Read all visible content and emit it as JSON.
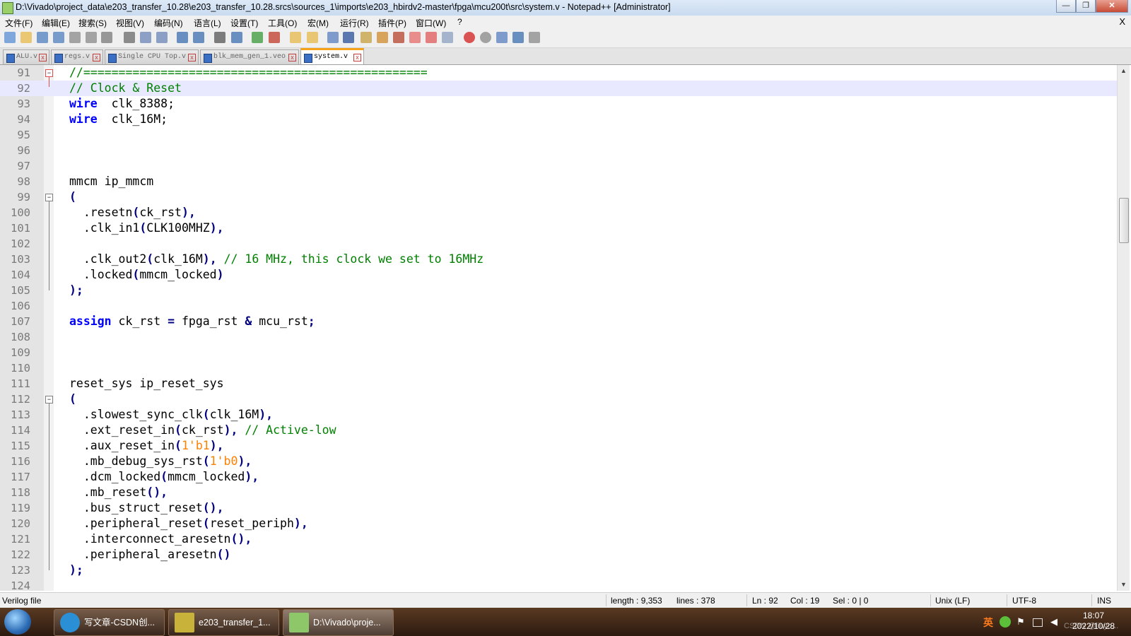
{
  "window": {
    "title": "D:\\Vivado\\project_data\\e203_transfer_10.28\\e203_transfer_10.28.srcs\\sources_1\\imports\\e203_hbirdv2-master\\fpga\\mcu200t\\src\\system.v - Notepad++ [Administrator]",
    "minimize_glyph": "—",
    "restore_glyph": "❐",
    "close_glyph": "✕"
  },
  "menu": {
    "items": [
      "文件(F)",
      "编辑(E)",
      "搜索(S)",
      "视图(V)",
      "编码(N)",
      "语言(L)",
      "设置(T)",
      "工具(O)",
      "宏(M)",
      "运行(R)",
      "插件(P)",
      "窗口(W)",
      "?"
    ],
    "close_glyph": "X"
  },
  "toolbar": {
    "icons": [
      "new-file-icon",
      "open-file-icon",
      "save-icon",
      "save-all-icon",
      "close-icon",
      "close-all-icon",
      "print-icon",
      "cut-icon",
      "copy-icon",
      "paste-icon",
      "undo-icon",
      "redo-icon",
      "find-icon",
      "replace-icon",
      "zoom-in-icon",
      "zoom-out-icon",
      "sync-vertical-icon",
      "sync-horizontal-icon",
      "word-wrap-icon",
      "show-all-chars-icon",
      "indent-guide-icon",
      "user-lang-icon",
      "doc-map-icon",
      "function-list-icon",
      "folder-workspace-icon",
      "monitor-icon",
      "record-macro-icon",
      "stop-record-icon",
      "play-macro-icon",
      "run-macro-multiple-icon",
      "save-macro-icon"
    ]
  },
  "tabs": [
    {
      "label": "ALU.v",
      "active": false
    },
    {
      "label": "regs.v",
      "active": false
    },
    {
      "label": "Single CPU Top.v",
      "active": false
    },
    {
      "label": "blk_mem_gen_1.veo",
      "active": false
    },
    {
      "label": "system.v",
      "active": true
    }
  ],
  "editor": {
    "current_line": 92,
    "lines": [
      {
        "n": "91",
        "t": [
          [
            "cm",
            "//================================================="
          ]
        ]
      },
      {
        "n": "92",
        "t": [
          [
            "cm",
            "// Clock & Reset"
          ]
        ]
      },
      {
        "n": "93",
        "t": [
          [
            "kw",
            "wire"
          ],
          [
            "",
            "  clk_8388;"
          ]
        ]
      },
      {
        "n": "94",
        "t": [
          [
            "kw",
            "wire"
          ],
          [
            "",
            "  clk_16M;"
          ]
        ]
      },
      {
        "n": "95",
        "t": []
      },
      {
        "n": "96",
        "t": []
      },
      {
        "n": "97",
        "t": []
      },
      {
        "n": "98",
        "t": [
          [
            "",
            "mmcm ip_mmcm"
          ]
        ]
      },
      {
        "n": "99",
        "t": [
          [
            "op",
            "("
          ]
        ]
      },
      {
        "n": "100",
        "t": [
          [
            "",
            "  .resetn"
          ],
          [
            "op",
            "("
          ],
          [
            "",
            "ck_rst"
          ],
          [
            "op",
            "),"
          ]
        ]
      },
      {
        "n": "101",
        "t": [
          [
            "",
            "  .clk_in1"
          ],
          [
            "op",
            "("
          ],
          [
            "",
            "CLK100MHZ"
          ],
          [
            "op",
            "),"
          ]
        ]
      },
      {
        "n": "102",
        "t": []
      },
      {
        "n": "103",
        "t": [
          [
            "",
            "  .clk_out2"
          ],
          [
            "op",
            "("
          ],
          [
            "",
            "clk_16M"
          ],
          [
            "op",
            "), "
          ],
          [
            "cm",
            "// 16 MHz, this clock we set to 16MHz"
          ]
        ]
      },
      {
        "n": "104",
        "t": [
          [
            "",
            "  .locked"
          ],
          [
            "op",
            "("
          ],
          [
            "",
            "mmcm_locked"
          ],
          [
            "op",
            ")"
          ]
        ]
      },
      {
        "n": "105",
        "t": [
          [
            "op",
            ");"
          ]
        ]
      },
      {
        "n": "106",
        "t": []
      },
      {
        "n": "107",
        "t": [
          [
            "kw",
            "assign"
          ],
          [
            "",
            " ck_rst "
          ],
          [
            "op",
            "="
          ],
          [
            "",
            " fpga_rst "
          ],
          [
            "op",
            "&"
          ],
          [
            "",
            " mcu_rst"
          ],
          [
            "op",
            ";"
          ]
        ]
      },
      {
        "n": "108",
        "t": []
      },
      {
        "n": "109",
        "t": []
      },
      {
        "n": "110",
        "t": []
      },
      {
        "n": "111",
        "t": [
          [
            "",
            "reset_sys ip_reset_sys"
          ]
        ]
      },
      {
        "n": "112",
        "t": [
          [
            "op",
            "("
          ]
        ]
      },
      {
        "n": "113",
        "t": [
          [
            "",
            "  .slowest_sync_clk"
          ],
          [
            "op",
            "("
          ],
          [
            "",
            "clk_16M"
          ],
          [
            "op",
            "),"
          ]
        ]
      },
      {
        "n": "114",
        "t": [
          [
            "",
            "  .ext_reset_in"
          ],
          [
            "op",
            "("
          ],
          [
            "",
            "ck_rst"
          ],
          [
            "op",
            "), "
          ],
          [
            "cm",
            "// Active-low"
          ]
        ]
      },
      {
        "n": "115",
        "t": [
          [
            "",
            "  .aux_reset_in"
          ],
          [
            "op",
            "("
          ],
          [
            "nm",
            "1'b1"
          ],
          [
            "op",
            "),"
          ]
        ]
      },
      {
        "n": "116",
        "t": [
          [
            "",
            "  .mb_debug_sys_rst"
          ],
          [
            "op",
            "("
          ],
          [
            "nm",
            "1'b0"
          ],
          [
            "op",
            "),"
          ]
        ]
      },
      {
        "n": "117",
        "t": [
          [
            "",
            "  .dcm_locked"
          ],
          [
            "op",
            "("
          ],
          [
            "",
            "mmcm_locked"
          ],
          [
            "op",
            "),"
          ]
        ]
      },
      {
        "n": "118",
        "t": [
          [
            "",
            "  .mb_reset"
          ],
          [
            "op",
            "(),"
          ]
        ]
      },
      {
        "n": "119",
        "t": [
          [
            "",
            "  .bus_struct_reset"
          ],
          [
            "op",
            "(),"
          ]
        ]
      },
      {
        "n": "120",
        "t": [
          [
            "",
            "  .peripheral_reset"
          ],
          [
            "op",
            "("
          ],
          [
            "",
            "reset_periph"
          ],
          [
            "op",
            "),"
          ]
        ]
      },
      {
        "n": "121",
        "t": [
          [
            "",
            "  .interconnect_aresetn"
          ],
          [
            "op",
            "(),"
          ]
        ]
      },
      {
        "n": "122",
        "t": [
          [
            "",
            "  .peripheral_aresetn"
          ],
          [
            "op",
            "()"
          ]
        ]
      },
      {
        "n": "123",
        "t": [
          [
            "op",
            ");"
          ]
        ]
      },
      {
        "n": "124",
        "t": []
      }
    ]
  },
  "status": {
    "file_type": "Verilog file",
    "length": "length : 9,353",
    "lines": "lines : 378",
    "ln": "Ln : 92",
    "col": "Col : 19",
    "sel": "Sel : 0 | 0",
    "eol": "Unix (LF)",
    "encoding": "UTF-8",
    "mode": "INS"
  },
  "taskbar": {
    "items": [
      {
        "label": "写文章-CSDN创...",
        "icon": "edge-browser-icon",
        "color": "#2b8fd6"
      },
      {
        "label": "e203_transfer_1...",
        "icon": "vivado-icon",
        "color": "#c9b23a"
      },
      {
        "label": "D:\\Vivado\\proje...",
        "icon": "notepad-plus-plus-icon",
        "color": "#8dc76a"
      }
    ],
    "time": "18:07",
    "date": "2022/10/28",
    "ime": "英",
    "watermark": "CSDN @liuyo..."
  }
}
